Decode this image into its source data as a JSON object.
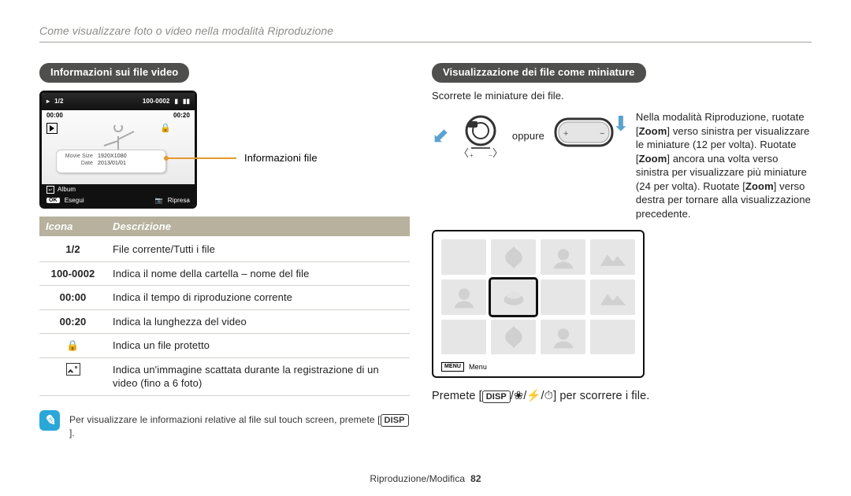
{
  "breadcrumb": "Come visualizzare foto o video nella modalità Riproduzione",
  "left": {
    "heading": "Informazioni sui file video",
    "lcd": {
      "counter": "1/2",
      "file_no": "100-0002",
      "time_cur": "00:00",
      "time_total": "00:20",
      "album": "Album",
      "ok": "OK",
      "exec": "Esegui",
      "shoot": "Ripresa",
      "info_movie_lbl": "Movie Size",
      "info_movie_val": "1920X1080",
      "info_date_lbl": "Date",
      "info_date_val": "2013/01/01"
    },
    "leadlabel": "Informazioni file",
    "table": {
      "head_icon": "Icona",
      "head_desc": "Descrizione",
      "rows": [
        {
          "icon": "1/2",
          "desc": "File corrente/Tutti i file"
        },
        {
          "icon": "100-0002",
          "desc": "Indica il nome della cartella – nome del file"
        },
        {
          "icon": "00:00",
          "desc": "Indica il tempo di riproduzione corrente"
        },
        {
          "icon": "00:20",
          "desc": "Indica la lunghezza del video"
        },
        {
          "icon": "lock",
          "desc": "Indica un file protetto"
        },
        {
          "icon": "thumb",
          "desc": "Indica un'immagine scattata durante la registrazione di un video (fino a 6 foto)"
        }
      ]
    },
    "note": "Per visualizzare le informazioni relative al file sul touch screen, premete ",
    "note_key": "DISP"
  },
  "right": {
    "heading": "Visualizzazione dei file come miniature",
    "sub": "Scorrete le miniature dei file.",
    "oppure": "oppure",
    "desc_pre": "Nella modalità Riproduzione, ruotate [",
    "desc_zoom1": "Zoom",
    "desc_mid1": "] verso sinistra per visualizzare le miniature (12 per volta). Ruotate [",
    "desc_zoom2": "Zoom",
    "desc_mid2": "] ancora una volta verso sinistra per visualizzare più miniature (24 per volta). Ruotate [",
    "desc_zoom3": "Zoom",
    "desc_end": "] verso destra per tornare alla visualizzazione precedente.",
    "preview_menu_key": "MENU",
    "preview_menu_lbl": "Menu",
    "instr_pre": "Premete [",
    "instr_disp": "DISP",
    "instr_sep": "/",
    "instr_post": "] per scorrere i file."
  },
  "footer": {
    "section": "Riproduzione/Modifica",
    "page": "82"
  }
}
